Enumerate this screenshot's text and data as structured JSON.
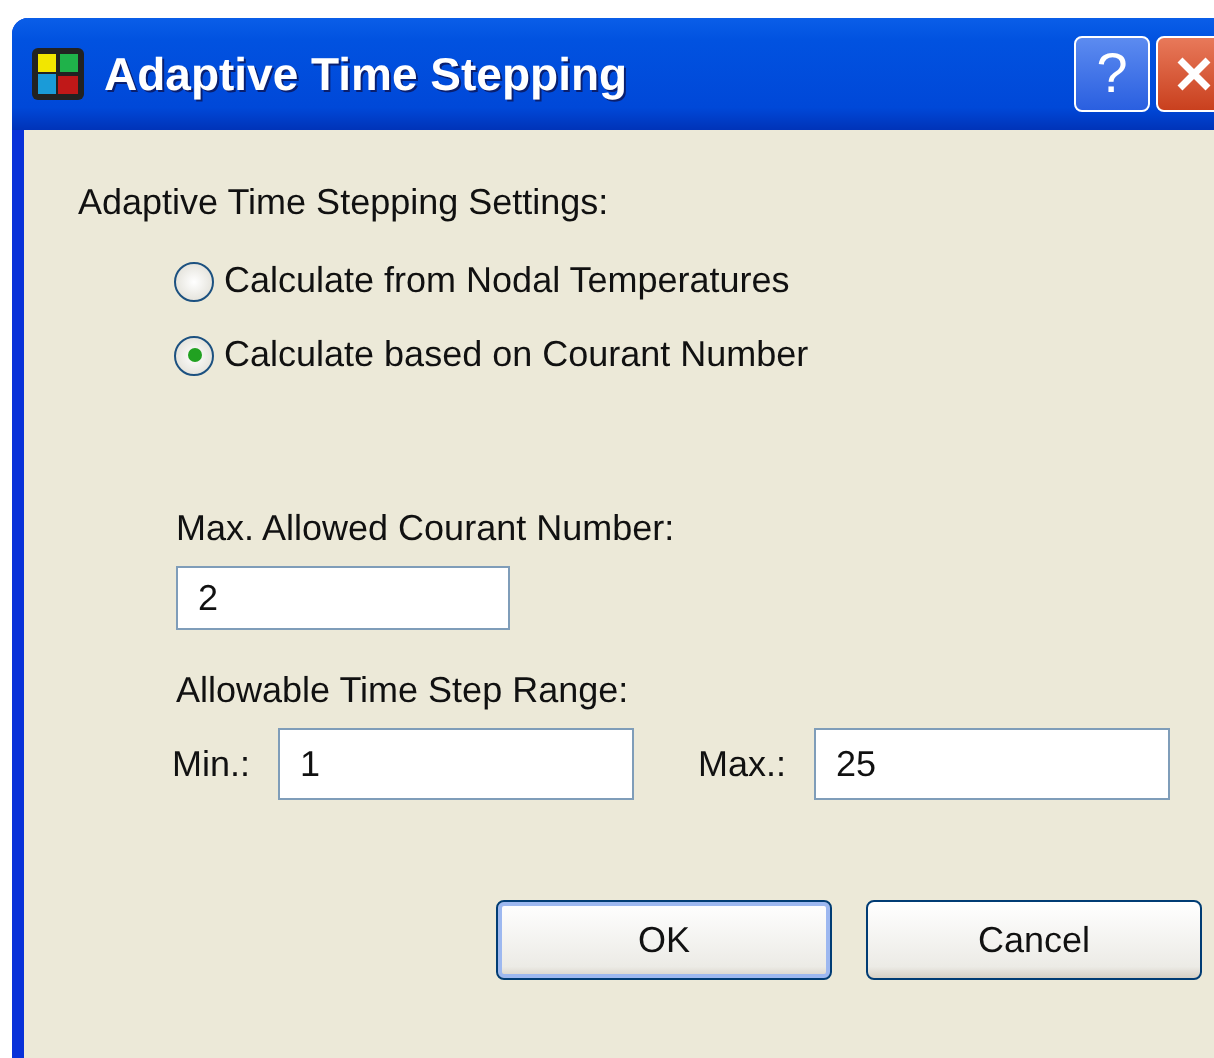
{
  "window": {
    "title": "Adaptive Time Stepping",
    "help_button": "?"
  },
  "section_label": "Adaptive Time Stepping Settings:",
  "options": [
    {
      "label": "Calculate from Nodal Temperatures",
      "selected": false
    },
    {
      "label": "Calculate based on Courant Number",
      "selected": true
    }
  ],
  "courant": {
    "label": "Max. Allowed Courant Number:",
    "value": "2"
  },
  "range": {
    "label": "Allowable Time Step Range:",
    "min_label": "Min.:",
    "min_value": "1",
    "max_label": "Max.:",
    "max_value": "25"
  },
  "buttons": [
    {
      "label": "OK",
      "kind": "default"
    },
    {
      "label": "Cancel",
      "kind": "normal"
    }
  ]
}
